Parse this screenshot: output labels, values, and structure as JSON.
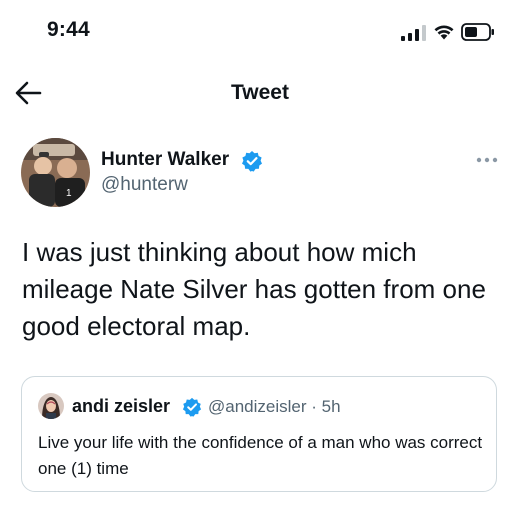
{
  "status_bar": {
    "time": "9:44"
  },
  "nav": {
    "back_icon": "arrow-left-icon",
    "title": "Tweet"
  },
  "tweet": {
    "author": {
      "name": "Hunter Walker",
      "handle": "@hunterw",
      "verified": true
    },
    "text": "I was just thinking about how mich mileage Nate Silver has gotten from one good electoral map.",
    "more_icon": "more-horizontal-icon"
  },
  "quoted_tweet": {
    "author": {
      "name": "andi zeisler",
      "handle": "@andizeisler",
      "verified": true
    },
    "separator": "·",
    "age": "5h",
    "text": "Live your life with the confidence of a man who was correct one (1) time"
  },
  "colors": {
    "primary_text": "#0f1419",
    "secondary_text": "#536471",
    "verified_blue": "#1d9bf0",
    "card_border": "#cfd9de"
  }
}
